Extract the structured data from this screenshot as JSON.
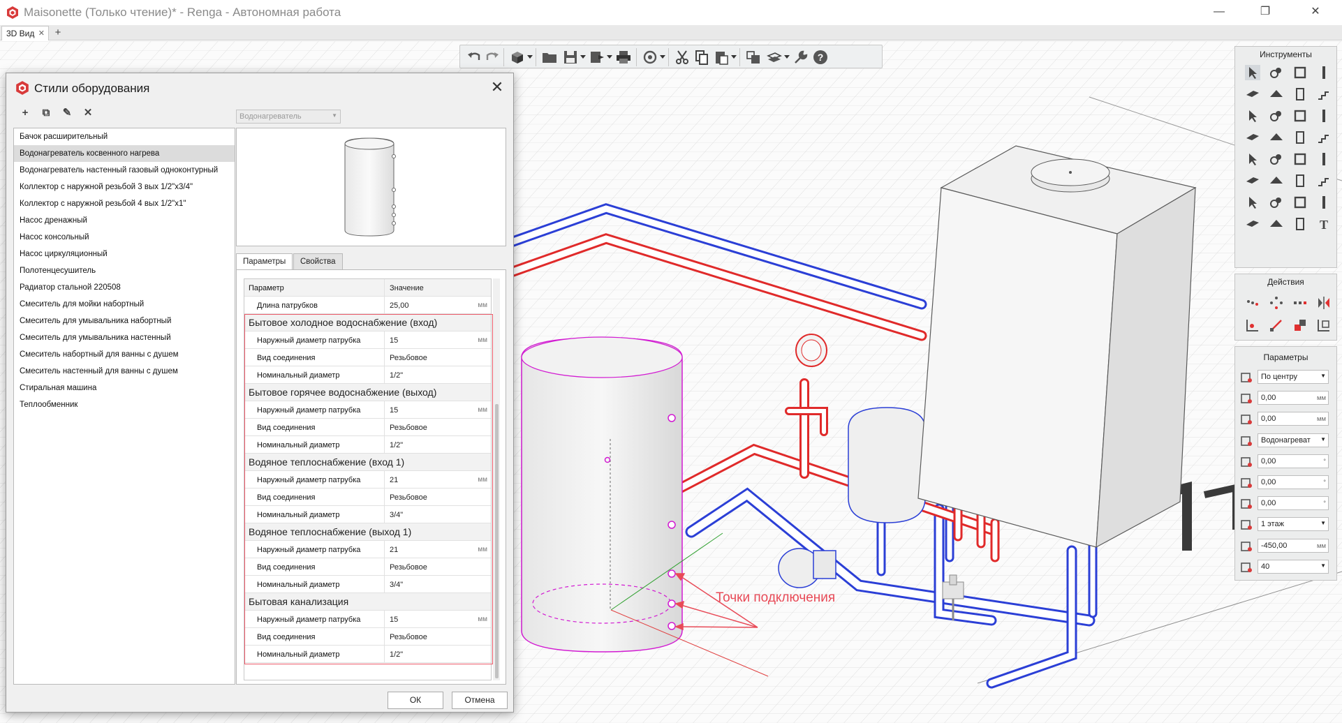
{
  "window": {
    "title": "Maisonette (Только чтение)* - Renga - Автономная работа",
    "controls": {
      "minimize": "—",
      "restore": "❐",
      "close": "✕"
    }
  },
  "tabs": [
    {
      "label": "3D Вид",
      "close": "✕"
    }
  ],
  "tab_add": "+",
  "toolbar": {
    "icons": [
      "undo-icon",
      "redo-icon",
      "cube-icon",
      "folder-icon",
      "save-icon",
      "export-icon",
      "print-icon",
      "orbit-icon",
      "cut-icon",
      "copy-icon",
      "paste-icon",
      "layers-icon",
      "views-icon",
      "wrench-icon",
      "help-icon"
    ]
  },
  "dialog": {
    "title": "Стили оборудования",
    "close": "✕",
    "tools": [
      "+",
      "⧉",
      "✎",
      "✕"
    ],
    "styles": [
      "Бачок расширительный",
      "Водонагреватель косвенного нагрева",
      "Водонагреватель настенный газовый одноконтурный",
      "Коллектор с наружной резьбой 3 вых 1/2\"x3/4\"",
      "Коллектор с наружной резьбой 4 вых 1/2\"x1\"",
      "Насос дренажный",
      "Насос консольный",
      "Насос циркуляционный",
      "Полотенцесушитель",
      "Радиатор стальной 220508",
      "Смеситель для мойки набортный",
      "Смеситель для умывальника набортный",
      "Смеситель для умывальника настенный",
      "Смеситель набортный для ванны с душем",
      "Смеситель настенный для ванны с душем",
      "Стиральная машина",
      "Теплообменник"
    ],
    "selected_index": 1,
    "type_select": "Водонагреватель",
    "param_tabs": [
      "Параметры",
      "Свойства"
    ],
    "table_header": {
      "name": "Параметр",
      "value": "Значение"
    },
    "first_row": {
      "name": "Длина патрубков",
      "value": "25,00",
      "unit": "мм"
    },
    "groups": [
      {
        "title": "Бытовое холодное водоснабжение (вход)",
        "rows": [
          {
            "name": "Наружный диаметр патрубка",
            "value": "15",
            "unit": "мм"
          },
          {
            "name": "Вид соединения",
            "value": "Резьбовое",
            "unit": ""
          },
          {
            "name": "Номинальный диаметр",
            "value": "1/2\"",
            "unit": ""
          }
        ]
      },
      {
        "title": "Бытовое горячее водоснабжение (выход)",
        "rows": [
          {
            "name": "Наружный диаметр патрубка",
            "value": "15",
            "unit": "мм"
          },
          {
            "name": "Вид соединения",
            "value": "Резьбовое",
            "unit": ""
          },
          {
            "name": "Номинальный диаметр",
            "value": "1/2\"",
            "unit": ""
          }
        ]
      },
      {
        "title": "Водяное теплоснабжение (вход 1)",
        "rows": [
          {
            "name": "Наружный диаметр патрубка",
            "value": "21",
            "unit": "мм"
          },
          {
            "name": "Вид соединения",
            "value": "Резьбовое",
            "unit": ""
          },
          {
            "name": "Номинальный диаметр",
            "value": "3/4\"",
            "unit": ""
          }
        ]
      },
      {
        "title": "Водяное теплоснабжение (выход 1)",
        "rows": [
          {
            "name": "Наружный диаметр патрубка",
            "value": "21",
            "unit": "мм"
          },
          {
            "name": "Вид соединения",
            "value": "Резьбовое",
            "unit": ""
          },
          {
            "name": "Номинальный диаметр",
            "value": "3/4\"",
            "unit": ""
          }
        ]
      },
      {
        "title": "Бытовая канализация",
        "rows": [
          {
            "name": "Наружный диаметр патрубка",
            "value": "15",
            "unit": "мм"
          },
          {
            "name": "Вид соединения",
            "value": "Резьбовое",
            "unit": ""
          },
          {
            "name": "Номинальный диаметр",
            "value": "1/2\"",
            "unit": ""
          }
        ]
      }
    ],
    "ok": "ОК",
    "cancel": "Отмена"
  },
  "panels": {
    "tools_title": "Инструменты",
    "actions_title": "Действия",
    "params_title": "Параметры",
    "params": [
      {
        "value": "По центру",
        "unit": "",
        "dropdown": true,
        "icon": "align-icon"
      },
      {
        "value": "0,00",
        "unit": "мм",
        "dropdown": false,
        "icon": "offset-x-icon"
      },
      {
        "value": "0,00",
        "unit": "мм",
        "dropdown": false,
        "icon": "offset-y-icon"
      },
      {
        "value": "Водонагреват",
        "unit": "",
        "dropdown": true,
        "icon": "style-icon"
      },
      {
        "value": "0,00",
        "unit": "°",
        "dropdown": false,
        "icon": "rotate-x-icon"
      },
      {
        "value": "0,00",
        "unit": "°",
        "dropdown": false,
        "icon": "rotate-y-icon"
      },
      {
        "value": "0,00",
        "unit": "°",
        "dropdown": false,
        "icon": "rotate-z-icon"
      },
      {
        "value": "1 этаж",
        "unit": "",
        "dropdown": true,
        "icon": "level-icon"
      },
      {
        "value": "-450,00",
        "unit": "мм",
        "dropdown": false,
        "icon": "elevation-icon"
      },
      {
        "value": "40",
        "unit": "",
        "dropdown": true,
        "icon": "mark-icon"
      }
    ]
  },
  "annotation": "Точки подключения",
  "colors": {
    "accent_red": "#e84a57",
    "pipe_blue": "#2b3fd6",
    "pipe_red": "#e02a2a",
    "selection_magenta": "#d21bd2"
  }
}
